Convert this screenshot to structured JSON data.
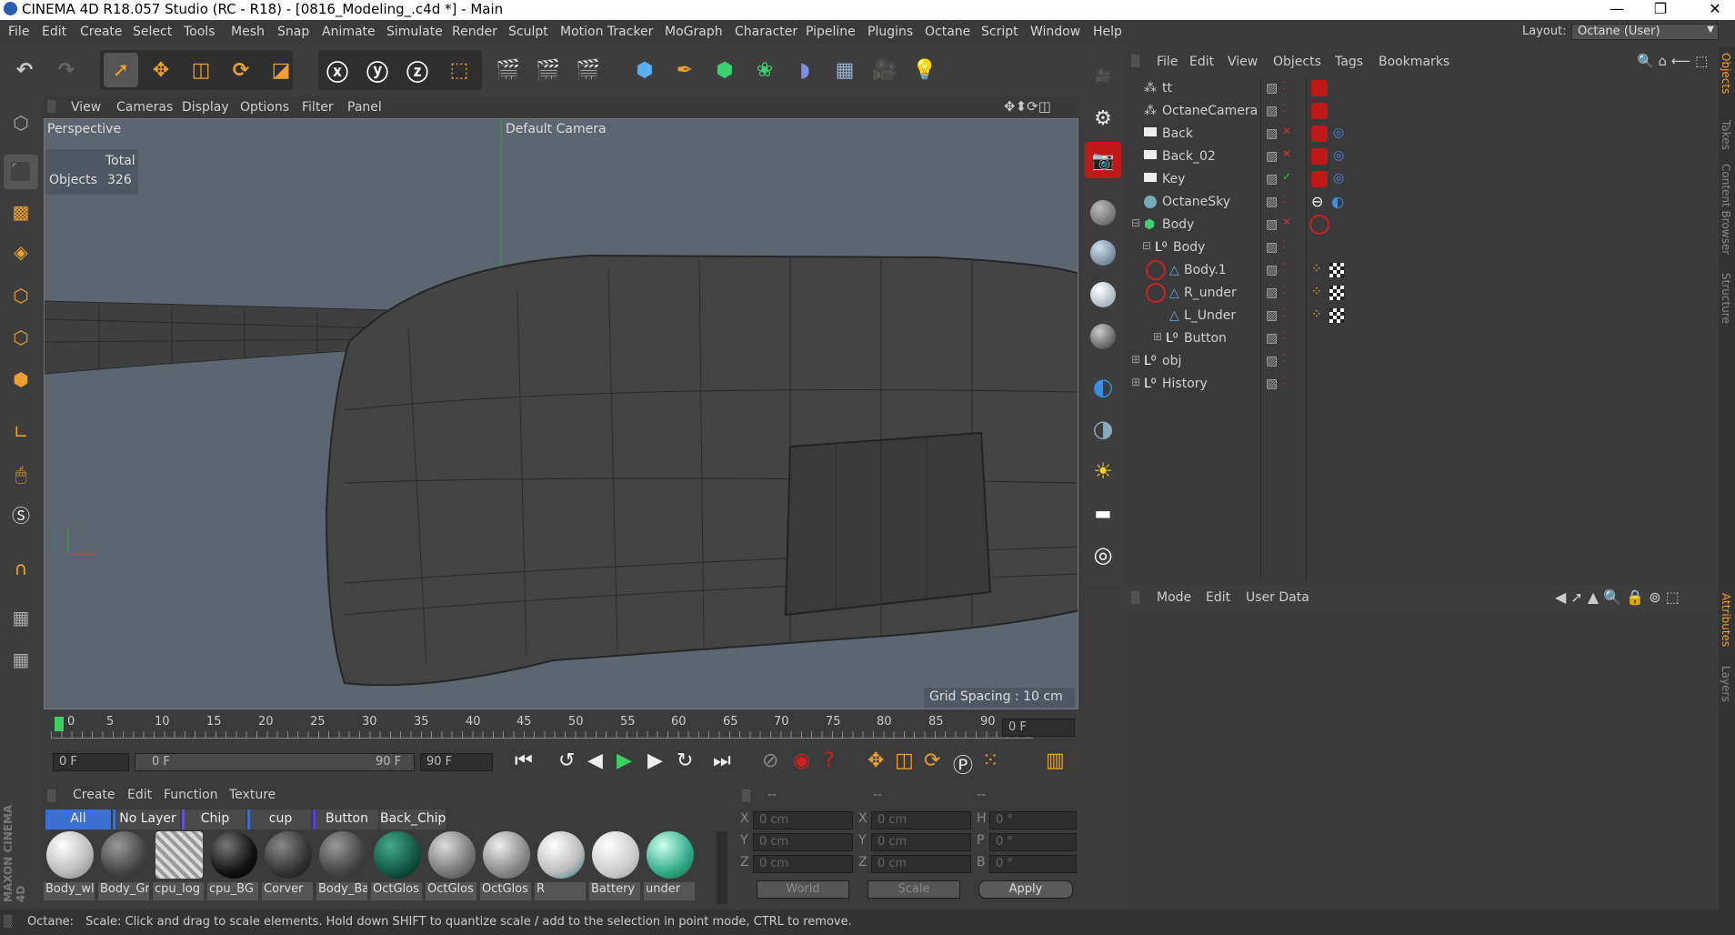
{
  "window": {
    "title": "CINEMA 4D R18.057 Studio (RC - R18) - [0816_Modeling_.c4d *] - Main"
  },
  "menu": [
    "File",
    "Edit",
    "Create",
    "Select",
    "Tools",
    "Mesh",
    "Snap",
    "Animate",
    "Simulate",
    "Render",
    "Sculpt",
    "Motion Tracker",
    "MoGraph",
    "Character",
    "Pipeline",
    "Plugins",
    "Octane",
    "Script",
    "Window",
    "Help"
  ],
  "layout": {
    "label": "Layout:",
    "value": "Octane (User)"
  },
  "viewport": {
    "menu": [
      "View",
      "Cameras",
      "Display",
      "Options",
      "Filter",
      "Panel"
    ],
    "projection": "Perspective",
    "camera": "Default Camera",
    "stats_header": "Total",
    "stats_label": "Objects",
    "stats_value": "326",
    "grid_spacing": "Grid Spacing : 10 cm"
  },
  "timeline": {
    "ticks": [
      "0",
      "5",
      "10",
      "15",
      "20",
      "25",
      "30",
      "35",
      "40",
      "45",
      "50",
      "55",
      "60",
      "65",
      "70",
      "75",
      "80",
      "85",
      "90"
    ],
    "current": "0 F",
    "start": "0 F",
    "range_start": "0 F",
    "range_end": "90 F",
    "end": "90 F"
  },
  "materials": {
    "menu": [
      "Create",
      "Edit",
      "Function",
      "Texture"
    ],
    "filters": [
      "All",
      "No Layer",
      "Chip",
      "cup",
      "Button",
      "Back_Chip"
    ],
    "items": [
      "Body_wl",
      "Body_Gr",
      "cpu_log",
      "cpu_BG",
      "Corver",
      "Body_Ba",
      "OctGlos",
      "OctGlos",
      "OctGlos",
      "R",
      "Battery",
      "under"
    ]
  },
  "coords": {
    "headers": [
      "--",
      "--",
      "--"
    ],
    "rows": [
      {
        "a": "X",
        "av": "0 cm",
        "b": "X",
        "bv": "0 cm",
        "c": "H",
        "cv": "0 °"
      },
      {
        "a": "Y",
        "av": "0 cm",
        "b": "Y",
        "bv": "0 cm",
        "c": "P",
        "cv": "0 °"
      },
      {
        "a": "Z",
        "av": "0 cm",
        "b": "Z",
        "bv": "0 cm",
        "c": "B",
        "cv": "0 °"
      }
    ],
    "world": "World",
    "scale": "Scale",
    "apply": "Apply"
  },
  "objects": {
    "menu": [
      "File",
      "Edit",
      "View",
      "Objects",
      "Tags",
      "Bookmarks"
    ],
    "rows": [
      "tt",
      "OctaneCamera",
      "Back",
      "Back_02",
      "Key",
      "OctaneSky",
      "Body",
      "Body",
      "Body.1",
      "R_under",
      "L_Under",
      "Button",
      "obj",
      "History"
    ]
  },
  "attributes": {
    "menu": [
      "Mode",
      "Edit",
      "User Data"
    ]
  },
  "side_tabs": [
    "Objects",
    "Takes",
    "Content Browser",
    "Structure",
    "Attributes",
    "Layers"
  ],
  "status": {
    "label": "Octane:",
    "text": "Scale: Click and drag to scale elements. Hold down SHIFT to quantize scale / add to the selection in point mode, CTRL to remove."
  },
  "colors": {
    "accent_orange": "#f0a030",
    "octane_red": "#d02020",
    "active_blue": "#3b6fd0",
    "viewport_bg": "#5c6670"
  }
}
